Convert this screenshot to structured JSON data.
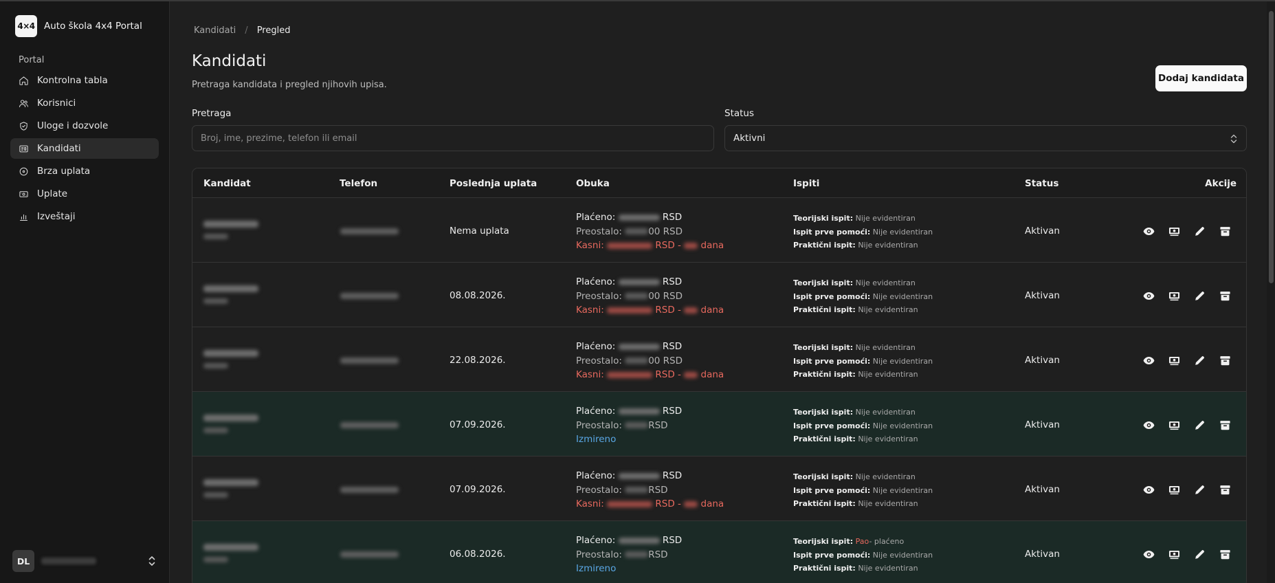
{
  "app": {
    "logo_text": "4×4",
    "title": "Auto škola 4x4 Portal"
  },
  "sidebar": {
    "section_label": "Portal",
    "items": [
      {
        "label": "Kontrolna tabla",
        "icon": "home-icon"
      },
      {
        "label": "Korisnici",
        "icon": "users-icon"
      },
      {
        "label": "Uloge i dozvole",
        "icon": "shield-icon"
      },
      {
        "label": "Kandidati",
        "icon": "id-card-icon",
        "active": true
      },
      {
        "label": "Brza uplata",
        "icon": "circle-dot-icon"
      },
      {
        "label": "Uplate",
        "icon": "banknote-icon"
      },
      {
        "label": "Izveštaji",
        "icon": "bar-chart-icon"
      }
    ],
    "user": {
      "initials": "DL"
    }
  },
  "breadcrumb": {
    "parent": "Kandidati",
    "separator": "/",
    "current": "Pregled"
  },
  "header": {
    "title": "Kandidati",
    "subtitle": "Pretraga kandidata i pregled njihovih upisa.",
    "add_button": "Dodaj kandidata"
  },
  "filters": {
    "search_label": "Pretraga",
    "search_placeholder": "Broj, ime, prezime, telefon ili email",
    "status_label": "Status",
    "status_value": "Aktivni"
  },
  "table": {
    "columns": [
      "Kandidat",
      "Telefon",
      "Poslednja uplata",
      "Obuka",
      "Ispiti",
      "Status",
      "Akcije"
    ],
    "labels": {
      "paid": "Plaćeno:",
      "remaining": "Preostalo:",
      "late": "Kasni:",
      "settled": "Izmireno",
      "currency": "RSD",
      "days": "dana",
      "theory": "Teorijski ispit:",
      "first_aid": "Ispit prve pomoći:",
      "practical": "Praktični ispit:",
      "not_recorded": "Nije evidentiran",
      "passed": "Pao",
      "paid_fee": "- plaćeno"
    },
    "rows": [
      {
        "last_payment": "Nema uplata",
        "remaining_suffix": "00 RSD",
        "late": true,
        "highlight": false,
        "theory": "Nije evidentiran",
        "status": "Aktivan"
      },
      {
        "last_payment": "08.08.2026.",
        "remaining_suffix": "00 RSD",
        "late": true,
        "highlight": false,
        "theory": "Nije evidentiran",
        "status": "Aktivan"
      },
      {
        "last_payment": "22.08.2026.",
        "remaining_suffix": "00 RSD",
        "late": true,
        "highlight": false,
        "theory": "Nije evidentiran",
        "status": "Aktivan"
      },
      {
        "last_payment": "07.09.2026.",
        "remaining_suffix": "RSD",
        "late": false,
        "highlight": true,
        "theory": "Nije evidentiran",
        "status": "Aktivan"
      },
      {
        "last_payment": "07.09.2026.",
        "remaining_suffix": "RSD",
        "late": true,
        "highlight": false,
        "theory": "Nije evidentiran",
        "status": "Aktivan"
      },
      {
        "last_payment": "06.08.2026.",
        "remaining_suffix": "RSD",
        "late": false,
        "highlight": true,
        "theory": "Pao",
        "status": "Aktivan"
      }
    ]
  },
  "colors": {
    "late": "#e8695e",
    "settled": "#5aa8e6",
    "highlight_row": "#1b2a26",
    "accent_button": "#fafafa"
  }
}
